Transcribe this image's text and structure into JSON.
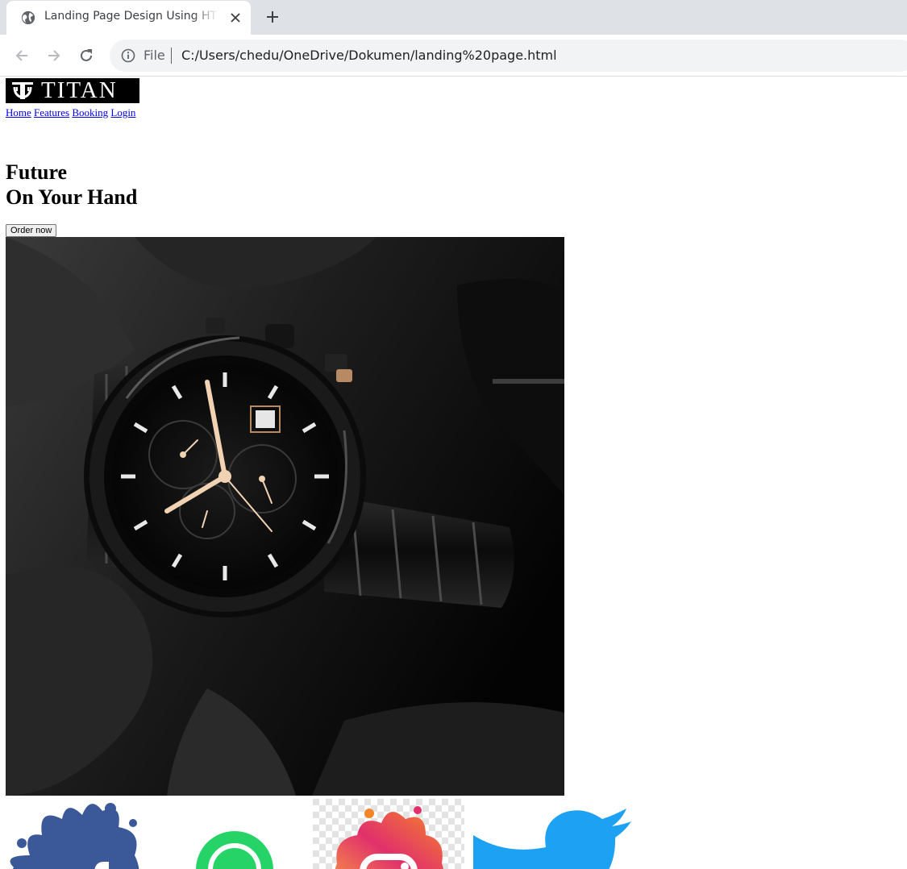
{
  "browser": {
    "tab_title": "Landing Page Design Using HTML",
    "url_scheme": "File",
    "url": "C:/Users/chedu/OneDrive/Dokumen/landing%20page.html"
  },
  "page": {
    "logo_text": "TITAN",
    "nav": [
      "Home",
      "Features",
      "Booking",
      "Login"
    ],
    "headline_line1": "Future",
    "headline_line2": "On Your Hand",
    "order_button": "Order now",
    "social_icons": [
      "facebook-icon",
      "whatsapp-icon",
      "instagram-icon",
      "twitter-icon"
    ]
  },
  "colors": {
    "link": "#0000ee",
    "facebook": "#3b5998",
    "whatsapp": "#25d366",
    "twitter": "#1da1f2"
  }
}
